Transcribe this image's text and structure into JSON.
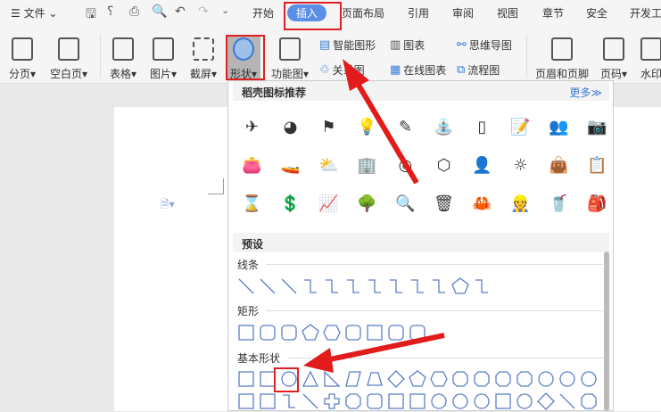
{
  "topbar": {
    "menu": "文件",
    "tabs": [
      "开始",
      "插入",
      "页面布局",
      "引用",
      "审阅",
      "视图",
      "章节",
      "安全",
      "开发工"
    ],
    "active": "插入"
  },
  "ribbon": {
    "big": [
      "分页",
      "空白页",
      "表格",
      "图片",
      "截屏",
      "形状",
      "功能图"
    ],
    "small": [
      "智能图形",
      "关系图",
      "图表",
      "在线图表",
      "思维导图",
      "流程图"
    ],
    "right": [
      "页眉和页脚",
      "页码",
      "水印"
    ]
  },
  "panel": {
    "header": "稻壳图标推荐",
    "more": "更多≫",
    "icons": [
      "✈",
      "◕",
      "⚑",
      "💡",
      "✎",
      "⛲",
      "▯",
      "📝",
      "👥",
      "📷",
      "👛",
      "🚤",
      "⛅",
      "🏢",
      "◎",
      "⬡",
      "👤",
      "☼",
      "👜",
      "📋",
      "⌛",
      "💲",
      "📈",
      "🌳",
      "🔍",
      "🗑",
      "🦀",
      "👷",
      "🥤",
      "🎒"
    ],
    "preset": "预设",
    "sections": {
      "lines": "线条",
      "rect": "矩形",
      "basic": "基本形状"
    }
  },
  "colors": {
    "accent": "#5b8ee6",
    "shape": "#5b7fc7",
    "red": "#e02020"
  }
}
